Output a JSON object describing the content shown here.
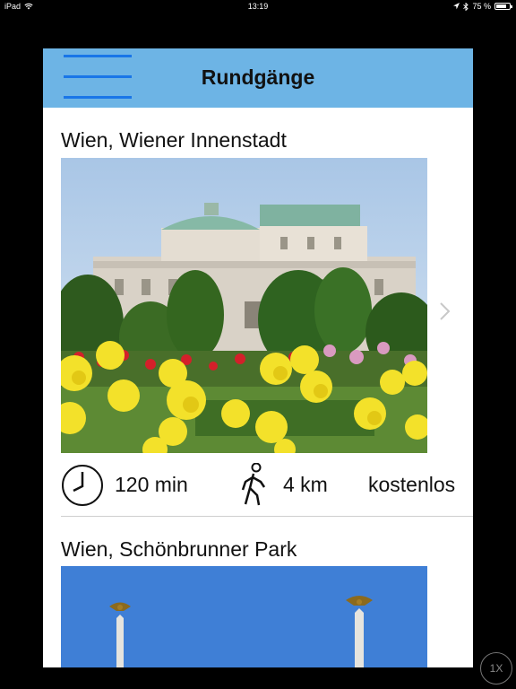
{
  "status_bar": {
    "device": "iPad",
    "wifi_icon": "wifi-icon",
    "time": "13:19",
    "location_icon": "location-arrow-icon",
    "bluetooth_icon": "bluetooth-icon",
    "battery_percent": "75 %"
  },
  "navbar": {
    "menu_icon": "hamburger-menu-icon",
    "title": "Rundgänge",
    "accent_color": "#6db4e5"
  },
  "tours": [
    {
      "title": "Wien, Wiener Innenstadt",
      "image": "burgtheater-with-yellow-roses",
      "duration": "120 min",
      "distance": "4 km",
      "price": "kostenlos",
      "chevron_icon": "chevron-right-icon"
    },
    {
      "title": "Wien, Schönbrunner Park",
      "image": "schoenbrunn-obelisks-with-eagles"
    }
  ],
  "zoom_button": {
    "label": "1X"
  }
}
